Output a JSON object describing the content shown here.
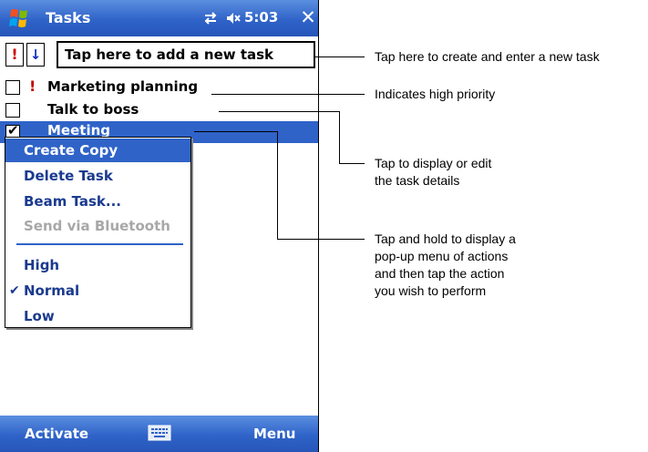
{
  "titlebar": {
    "title": "Tasks",
    "time": "5:03",
    "close_label": "✕",
    "icons": [
      "windows-start-icon",
      "connectivity-icon",
      "speaker-muted-icon"
    ]
  },
  "entry_bar": {
    "priority_high_label": "!",
    "priority_low_label": "↓",
    "new_task_placeholder": "Tap here to add a new task"
  },
  "tasks": [
    {
      "label": "Marketing planning",
      "priority": "!",
      "checked": false
    },
    {
      "label": "Talk to boss",
      "priority": "",
      "checked": false
    },
    {
      "label": "Meeting",
      "priority": "",
      "checked": true,
      "selected": true
    }
  ],
  "context_menu": {
    "items": [
      {
        "label": "Create Copy",
        "state": "selected"
      },
      {
        "label": "Delete Task",
        "state": "normal"
      },
      {
        "label": "Beam Task...",
        "state": "normal"
      },
      {
        "label": "Send via Bluetooth",
        "state": "disabled"
      },
      {
        "label": "High",
        "state": "normal"
      },
      {
        "label": "Normal",
        "state": "checked"
      },
      {
        "label": "Low",
        "state": "normal"
      }
    ],
    "check_glyph": "✔"
  },
  "softkeys": {
    "left": "Activate",
    "right": "Menu"
  },
  "callouts": {
    "new_task": "Tap here to create and enter a new task",
    "high_priority": "Indicates high priority",
    "details_line1": "Tap to display or edit",
    "details_line2": "the task details",
    "popup_line1": "Tap and hold to display a",
    "popup_line2": "pop-up menu of actions",
    "popup_line3": "and then tap the action",
    "popup_line4": "you wish to perform"
  },
  "colors": {
    "bar_blue": "#2f63c8",
    "menu_text": "#1a3a8f",
    "priority_red": "#c00000",
    "disabled_gray": "#a8a8a8"
  }
}
